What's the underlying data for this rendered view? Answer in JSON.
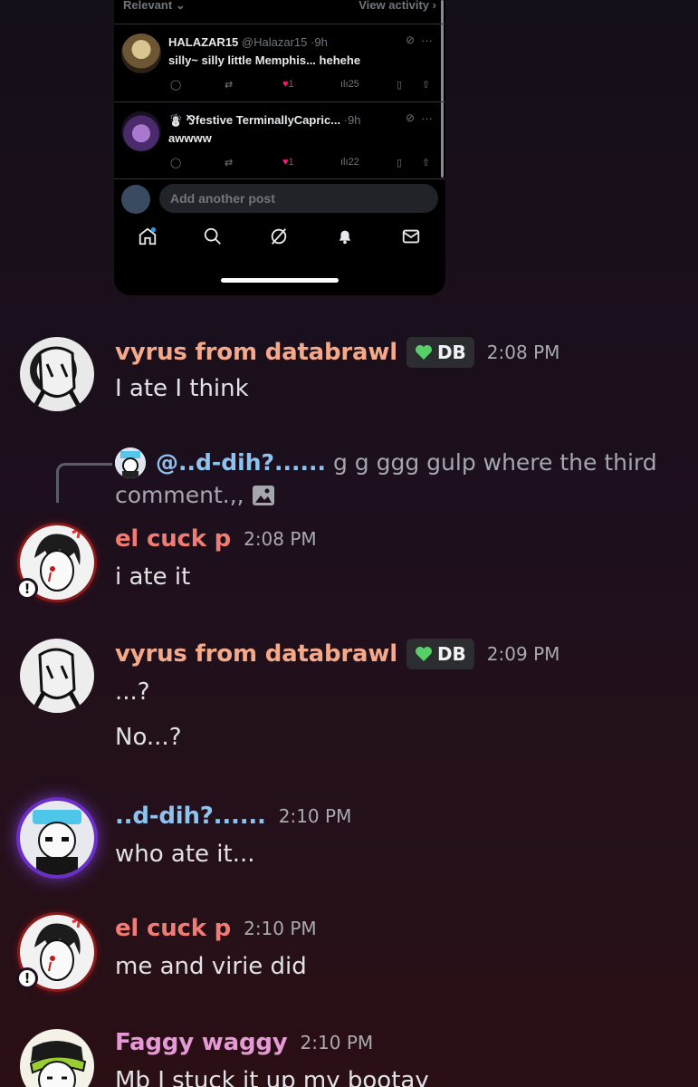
{
  "embed": {
    "sort_label": "Relevant",
    "view_activity": "View activity",
    "tweets": [
      {
        "name": "HALAZAR15",
        "handle": "@Halazar15",
        "time": "9h",
        "text": "silly~ silly little Memphis... hehehe",
        "likes": "1",
        "views": "25"
      },
      {
        "name": "☃️ ⅋festive TerminallyCapric...",
        "handle": "",
        "time": "9h",
        "text": "awwww",
        "likes": "1",
        "views": "22"
      }
    ],
    "compose_placeholder": "Add another post",
    "nav": [
      "home-icon",
      "search-icon",
      "grok-icon",
      "bell-icon",
      "mail-icon"
    ]
  },
  "messages": [
    {
      "author": "vyrus from databrawl",
      "author_color": "#f4a98a",
      "tag": "DB",
      "time": "2:08 PM",
      "lines": [
        "I ate I think"
      ]
    },
    {
      "reply": {
        "name": "@..d-dih?......",
        "text": "g g ggg gulp  where the third",
        "text2": "comment.,,"
      },
      "author": "el cuck p",
      "author_color": "#f07c73",
      "time": "2:08 PM",
      "lines": [
        "i ate it"
      ]
    },
    {
      "author": "vyrus from databrawl",
      "author_color": "#f4a98a",
      "tag": "DB",
      "time": "2:09 PM",
      "lines": [
        "...?",
        "No...?"
      ]
    },
    {
      "author": "..d-dih?......",
      "author_color": "#8fc3ef",
      "time": "2:10 PM",
      "lines": [
        "who ate it..."
      ]
    },
    {
      "author": "el cuck p",
      "author_color": "#f07c73",
      "time": "2:10 PM",
      "lines": [
        "me and virie did"
      ]
    },
    {
      "author": "Faggy waggy",
      "author_color": "#e59ad6",
      "time": "2:10 PM",
      "lines": [
        "Mb I stuck it up my bootay"
      ]
    }
  ],
  "colors": {
    "tag_heart": "#57d06a",
    "likes": "#f91880"
  }
}
